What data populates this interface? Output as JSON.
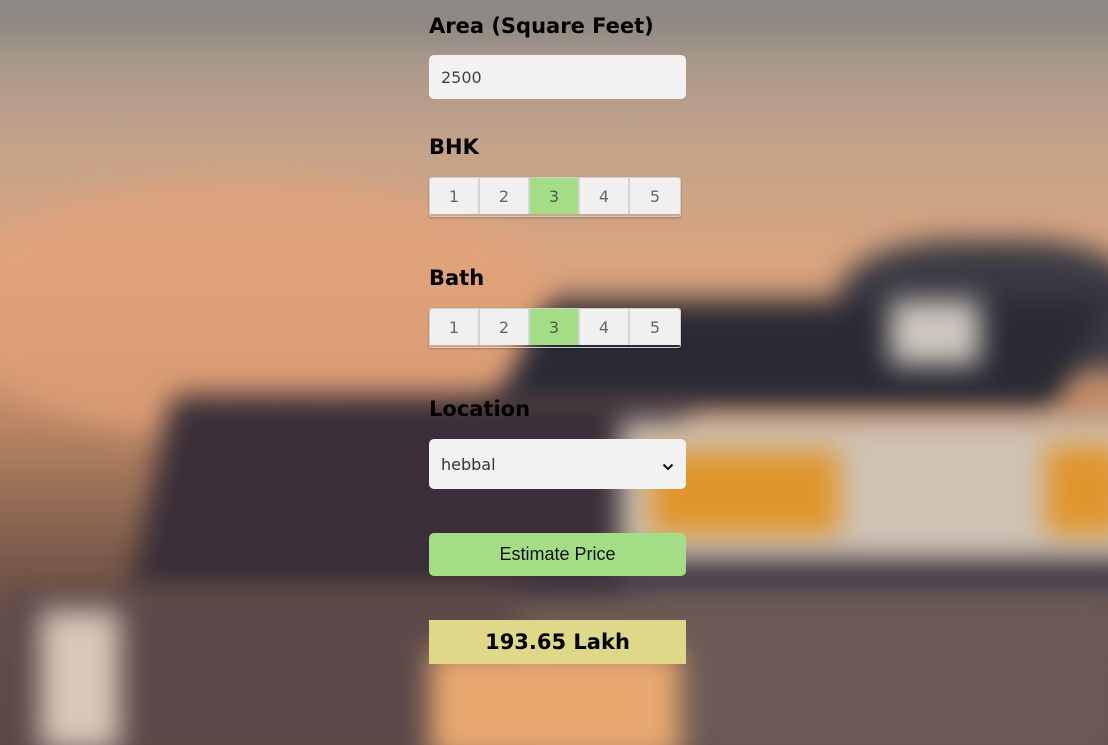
{
  "area": {
    "label": "Area (Square Feet)",
    "value": "2500"
  },
  "bhk": {
    "label": "BHK",
    "options": [
      "1",
      "2",
      "3",
      "4",
      "5"
    ],
    "selected": "3"
  },
  "bath": {
    "label": "Bath",
    "options": [
      "1",
      "2",
      "3",
      "4",
      "5"
    ],
    "selected": "3"
  },
  "location": {
    "label": "Location",
    "selected": "hebbal"
  },
  "estimate_button": {
    "label": "Estimate Price"
  },
  "result": {
    "text": "193.65 Lakh"
  },
  "colors": {
    "selected_option": "#a3dd85",
    "button": "#a3dd85",
    "result_background": "#dfd888"
  },
  "icons": {
    "select_arrow": "chevron-down-icon"
  }
}
